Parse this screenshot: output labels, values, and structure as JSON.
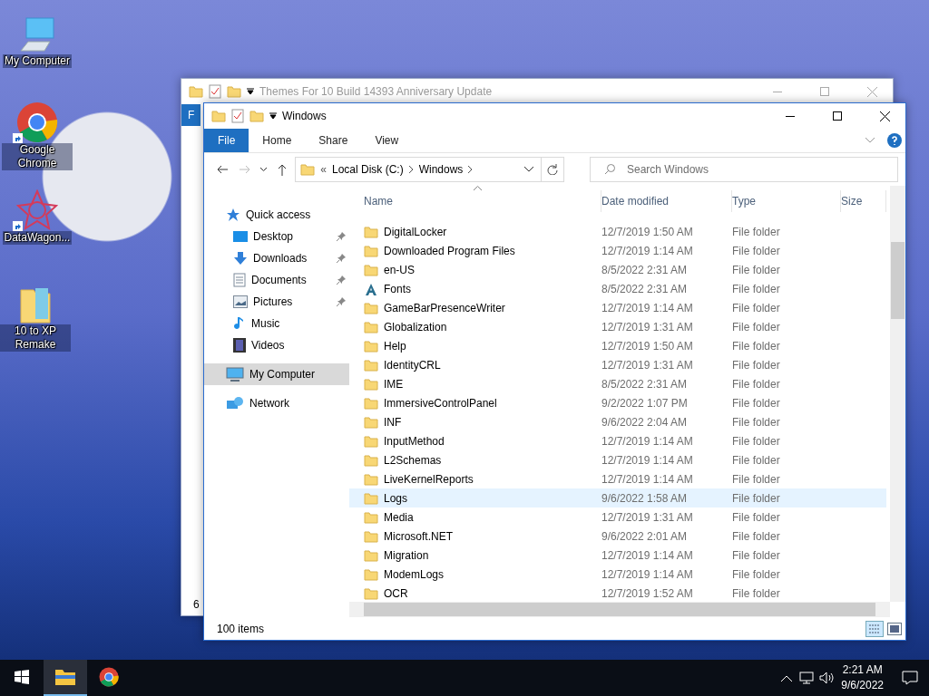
{
  "desktop_icons": [
    {
      "label": "My Computer",
      "kind": "computer",
      "shortcut": false
    },
    {
      "label": "Google Chrome",
      "kind": "chrome",
      "shortcut": true
    },
    {
      "label": "DataWagon...",
      "kind": "star",
      "shortcut": true
    },
    {
      "label": "10 to XP Remake",
      "kind": "folder",
      "shortcut": false
    }
  ],
  "back_window": {
    "title": "Themes For 10 Build 14393 Anniversary Update",
    "ribbon_tab": "F",
    "status": "6"
  },
  "window": {
    "title": "Windows",
    "ribbon_tabs": [
      {
        "label": "File",
        "selected": true
      },
      {
        "label": "Home",
        "selected": false
      },
      {
        "label": "Share",
        "selected": false
      },
      {
        "label": "View",
        "selected": false
      }
    ],
    "address": {
      "overflow": "«",
      "crumbs": [
        "Local Disk (C:)",
        "Windows"
      ]
    },
    "search": {
      "placeholder": "Search Windows"
    },
    "nav": [
      {
        "label": "Quick access",
        "kind": "star",
        "selected": false,
        "children": [
          {
            "label": "Desktop",
            "kind": "desktop",
            "pinned": true,
            "selected": false
          },
          {
            "label": "Downloads",
            "kind": "download",
            "pinned": true,
            "selected": false
          },
          {
            "label": "Documents",
            "kind": "document",
            "pinned": true,
            "selected": false
          },
          {
            "label": "Pictures",
            "kind": "picture",
            "pinned": true,
            "selected": false
          },
          {
            "label": "Music",
            "kind": "music",
            "pinned": false,
            "selected": false
          },
          {
            "label": "Videos",
            "kind": "video",
            "pinned": false,
            "selected": false
          }
        ]
      },
      {
        "label": "My Computer",
        "kind": "computer",
        "selected": true
      },
      {
        "label": "Network",
        "kind": "network",
        "selected": false
      }
    ],
    "columns": [
      "Name",
      "Date modified",
      "Type",
      "Size"
    ],
    "rows": [
      {
        "name": "DigitalLocker",
        "date": "12/7/2019 1:50 AM",
        "type": "File folder",
        "kind": "folder",
        "hovered": false
      },
      {
        "name": "Downloaded Program Files",
        "date": "12/7/2019 1:14 AM",
        "type": "File folder",
        "kind": "folder",
        "hovered": false
      },
      {
        "name": "en-US",
        "date": "8/5/2022 2:31 AM",
        "type": "File folder",
        "kind": "folder",
        "hovered": false
      },
      {
        "name": "Fonts",
        "date": "8/5/2022 2:31 AM",
        "type": "File folder",
        "kind": "fonts",
        "hovered": false
      },
      {
        "name": "GameBarPresenceWriter",
        "date": "12/7/2019 1:14 AM",
        "type": "File folder",
        "kind": "folder",
        "hovered": false
      },
      {
        "name": "Globalization",
        "date": "12/7/2019 1:31 AM",
        "type": "File folder",
        "kind": "folder",
        "hovered": false
      },
      {
        "name": "Help",
        "date": "12/7/2019 1:50 AM",
        "type": "File folder",
        "kind": "folder",
        "hovered": false
      },
      {
        "name": "IdentityCRL",
        "date": "12/7/2019 1:31 AM",
        "type": "File folder",
        "kind": "folder",
        "hovered": false
      },
      {
        "name": "IME",
        "date": "8/5/2022 2:31 AM",
        "type": "File folder",
        "kind": "folder",
        "hovered": false
      },
      {
        "name": "ImmersiveControlPanel",
        "date": "9/2/2022 1:07 PM",
        "type": "File folder",
        "kind": "folder",
        "hovered": false
      },
      {
        "name": "INF",
        "date": "9/6/2022 2:04 AM",
        "type": "File folder",
        "kind": "folder",
        "hovered": false
      },
      {
        "name": "InputMethod",
        "date": "12/7/2019 1:14 AM",
        "type": "File folder",
        "kind": "folder",
        "hovered": false
      },
      {
        "name": "L2Schemas",
        "date": "12/7/2019 1:14 AM",
        "type": "File folder",
        "kind": "folder",
        "hovered": false
      },
      {
        "name": "LiveKernelReports",
        "date": "12/7/2019 1:14 AM",
        "type": "File folder",
        "kind": "folder",
        "hovered": false
      },
      {
        "name": "Logs",
        "date": "9/6/2022 1:58 AM",
        "type": "File folder",
        "kind": "folder",
        "hovered": true
      },
      {
        "name": "Media",
        "date": "12/7/2019 1:31 AM",
        "type": "File folder",
        "kind": "folder",
        "hovered": false
      },
      {
        "name": "Microsoft.NET",
        "date": "9/6/2022 2:01 AM",
        "type": "File folder",
        "kind": "folder",
        "hovered": false
      },
      {
        "name": "Migration",
        "date": "12/7/2019 1:14 AM",
        "type": "File folder",
        "kind": "folder",
        "hovered": false
      },
      {
        "name": "ModemLogs",
        "date": "12/7/2019 1:14 AM",
        "type": "File folder",
        "kind": "folder",
        "hovered": false
      },
      {
        "name": "OCR",
        "date": "12/7/2019 1:52 AM",
        "type": "File folder",
        "kind": "folder",
        "hovered": false
      }
    ],
    "status": "100 items"
  },
  "taskbar": {
    "apps": [
      {
        "kind": "explorer",
        "active": true
      },
      {
        "kind": "chrome",
        "active": false
      }
    ],
    "time": "2:21 AM",
    "date": "9/6/2022"
  }
}
